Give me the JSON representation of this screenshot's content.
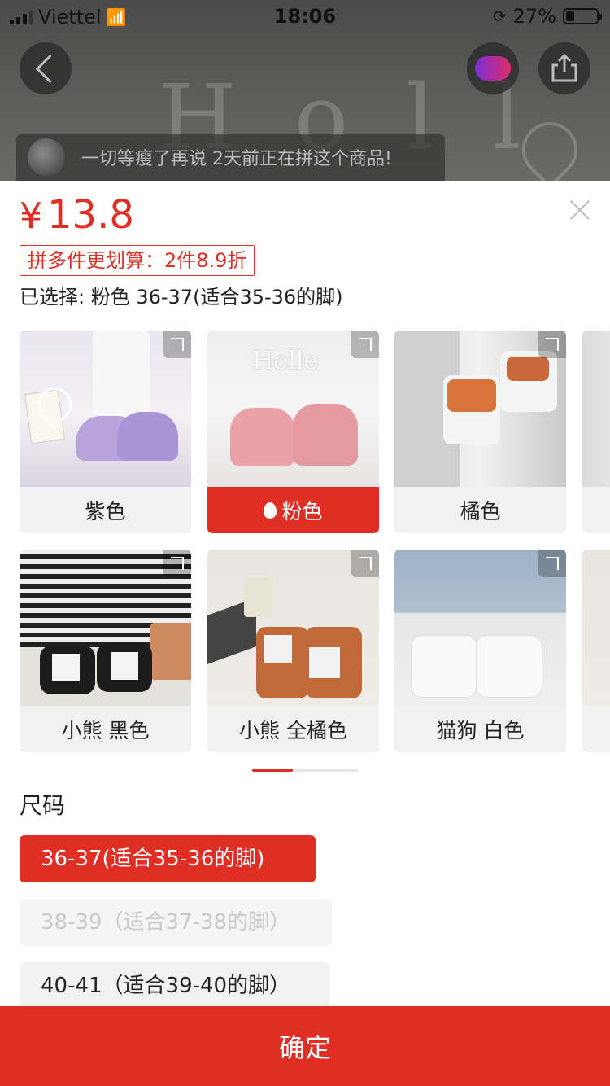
{
  "status_bar": {
    "carrier": "Viettel",
    "time": "18:06",
    "battery": "27%",
    "battery_level": 0.27
  },
  "notice": {
    "text": "一切等瘦了再说 2天前正在拼这个商品!"
  },
  "product": {
    "currency": "¥",
    "price": "13.8",
    "promo": "拼多件更划算：2件8.9折",
    "selected": "已选择: 粉色 36-37(适合35-36的脚)"
  },
  "colors": [
    {
      "label": "紫色"
    },
    {
      "label": "粉色",
      "active": true
    },
    {
      "label": "橘色"
    },
    {
      "label": "小熊 黑色"
    },
    {
      "label": "小熊 全橘色"
    },
    {
      "label": "猫狗 白色"
    }
  ],
  "size": {
    "title": "尺码",
    "options": [
      {
        "label": "36-37(适合35-36的脚)",
        "state": "selected"
      },
      {
        "label": "38-39（适合37-38的脚）",
        "state": "disabled"
      },
      {
        "label": "40-41（适合39-40的脚）",
        "state": "normal"
      }
    ]
  },
  "confirm_label": "确定",
  "theme": {
    "accent": "#e02e24"
  }
}
